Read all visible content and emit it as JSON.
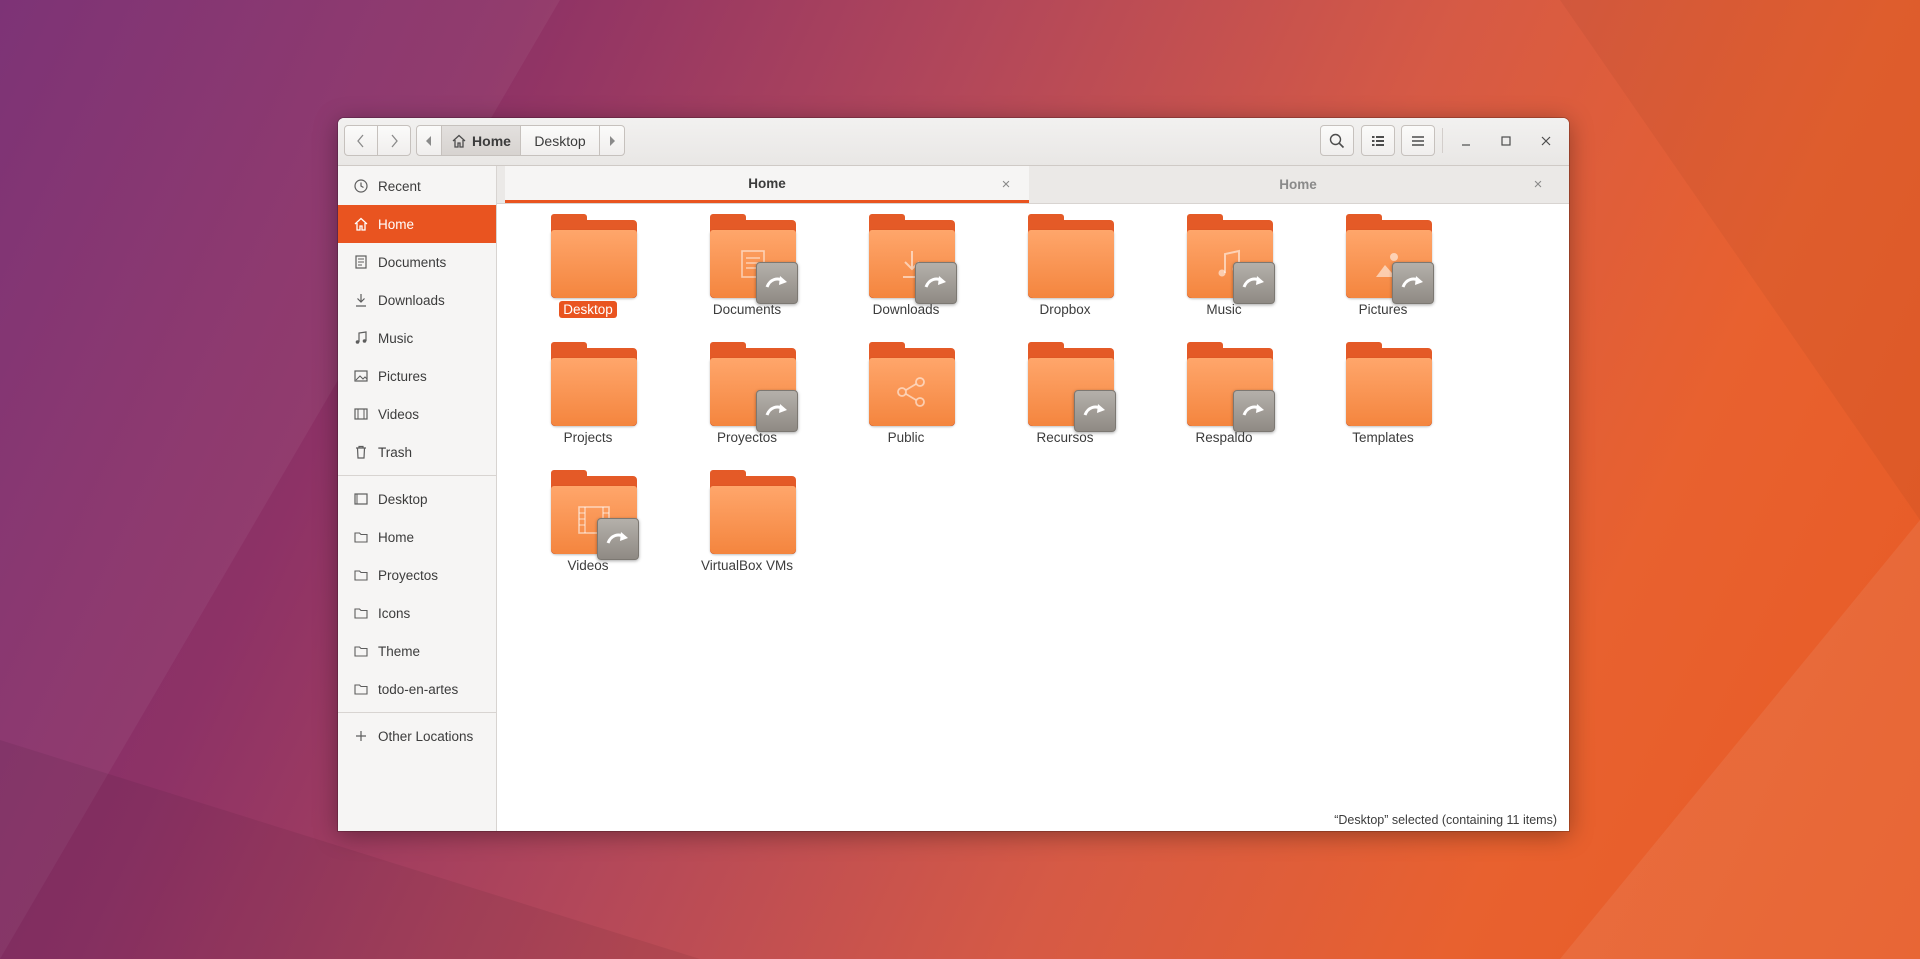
{
  "headerbar": {
    "back_icon": "chevron-left-icon",
    "forward_icon": "chevron-right-icon",
    "path": [
      {
        "label": "Home",
        "icon": "home-icon",
        "active": true
      },
      {
        "label": "Desktop",
        "active": false
      }
    ]
  },
  "sidebar": {
    "places": [
      {
        "label": "Recent",
        "icon": "clock-icon"
      },
      {
        "label": "Home",
        "icon": "home-icon",
        "active": true
      },
      {
        "label": "Documents",
        "icon": "document-icon"
      },
      {
        "label": "Downloads",
        "icon": "download-icon"
      },
      {
        "label": "Music",
        "icon": "music-icon"
      },
      {
        "label": "Pictures",
        "icon": "picture-icon"
      },
      {
        "label": "Videos",
        "icon": "film-icon"
      },
      {
        "label": "Trash",
        "icon": "trash-icon"
      }
    ],
    "bookmarks": [
      {
        "label": "Desktop",
        "icon": "desktop-icon"
      },
      {
        "label": "Home",
        "icon": "folder-icon"
      },
      {
        "label": "Proyectos",
        "icon": "folder-icon"
      },
      {
        "label": "Icons",
        "icon": "folder-icon"
      },
      {
        "label": "Theme",
        "icon": "folder-icon"
      },
      {
        "label": "todo-en-artes",
        "icon": "folder-icon"
      }
    ],
    "other_locations": {
      "label": "Other Locations",
      "icon": "plus-icon"
    }
  },
  "tabs": [
    {
      "label": "Home",
      "active": true
    },
    {
      "label": "Home",
      "active": false
    }
  ],
  "files": [
    {
      "label": "Desktop",
      "glyph": "",
      "link": false,
      "selected": true
    },
    {
      "label": "Documents",
      "glyph": "document",
      "link": true
    },
    {
      "label": "Downloads",
      "glyph": "download",
      "link": true
    },
    {
      "label": "Dropbox",
      "glyph": "",
      "link": false
    },
    {
      "label": "Music",
      "glyph": "music",
      "link": true
    },
    {
      "label": "Pictures",
      "glyph": "picture",
      "link": true
    },
    {
      "label": "Projects",
      "glyph": "",
      "link": false
    },
    {
      "label": "Proyectos",
      "glyph": "",
      "link": true
    },
    {
      "label": "Public",
      "glyph": "share",
      "link": false
    },
    {
      "label": "Recursos",
      "glyph": "",
      "link": true
    },
    {
      "label": "Respaldo",
      "glyph": "",
      "link": true
    },
    {
      "label": "Templates",
      "glyph": "",
      "link": false
    },
    {
      "label": "Videos",
      "glyph": "film",
      "link": true
    },
    {
      "label": "VirtualBox VMs",
      "glyph": "",
      "link": false
    }
  ],
  "status": "“Desktop” selected  (containing 11 items)",
  "colors": {
    "accent": "#e95420",
    "folder_front": "#f4853e",
    "folder_back": "#e45a27"
  }
}
